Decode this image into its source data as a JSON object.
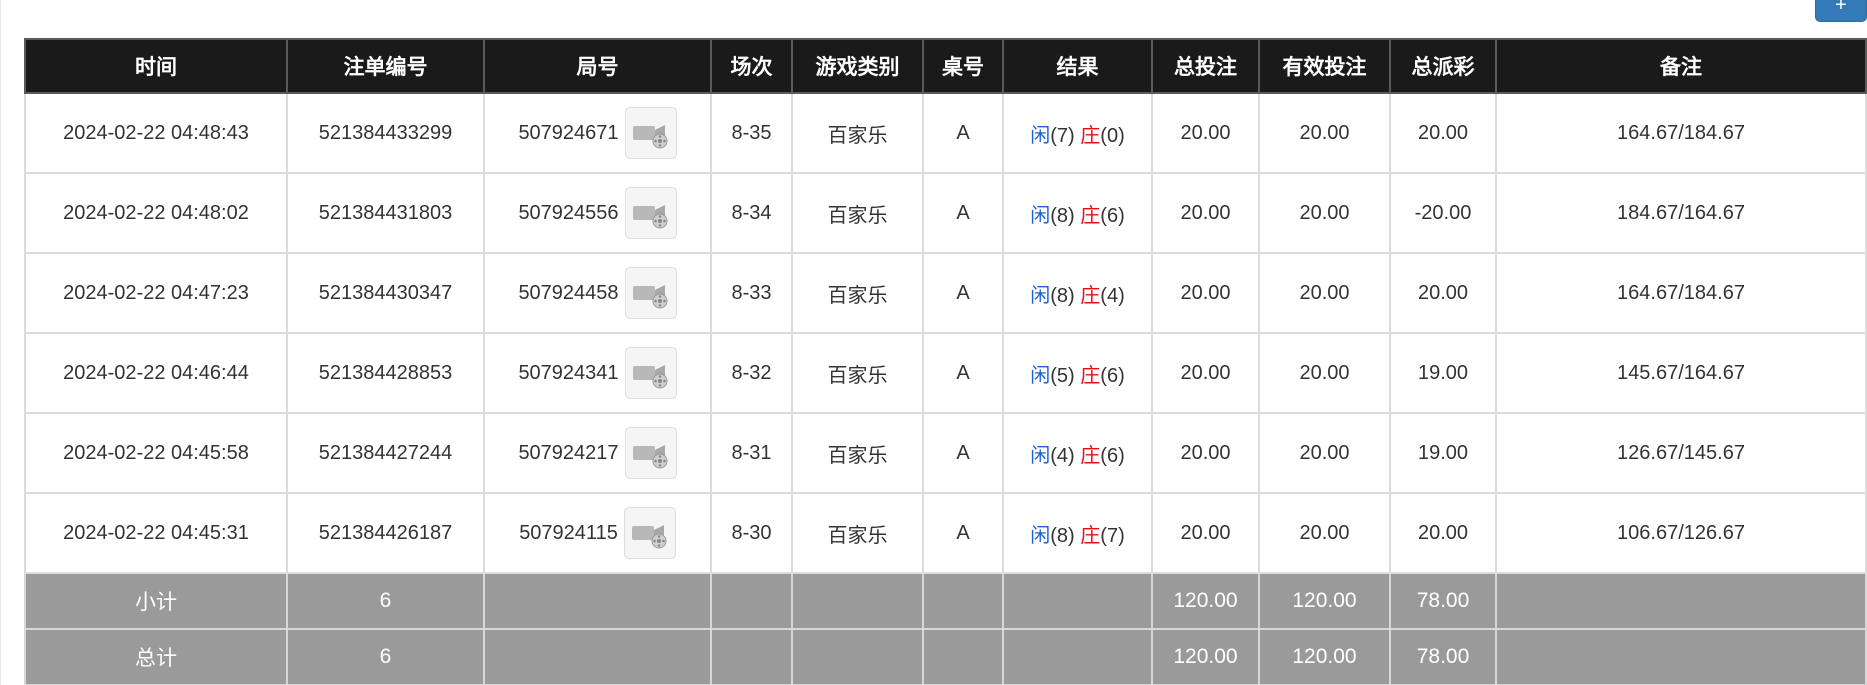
{
  "corner_button": {
    "label": "+"
  },
  "table": {
    "headers": [
      "时间",
      "注单编号",
      "局号",
      "场次",
      "游戏类别",
      "桌号",
      "结果",
      "总投注",
      "有效投注",
      "总派彩",
      "备注"
    ],
    "rows": [
      {
        "time": "2024-02-22 04:48:43",
        "bet_id": "521384433299",
        "round_id": "507924671",
        "session": "8-35",
        "game_type": "百家乐",
        "table_no": "A",
        "player_label": "闲",
        "player_score": "(7)",
        "banker_label": "庄",
        "banker_score": "(0)",
        "total_bet": "20.00",
        "valid_bet": "20.00",
        "payout": "20.00",
        "payout_status": "positive",
        "note": "164.67/184.67"
      },
      {
        "time": "2024-02-22 04:48:02",
        "bet_id": "521384431803",
        "round_id": "507924556",
        "session": "8-34",
        "game_type": "百家乐",
        "table_no": "A",
        "player_label": "闲",
        "player_score": "(8)",
        "banker_label": "庄",
        "banker_score": "(6)",
        "total_bet": "20.00",
        "valid_bet": "20.00",
        "payout": "-20.00",
        "payout_status": "negative",
        "note": "184.67/164.67"
      },
      {
        "time": "2024-02-22 04:47:23",
        "bet_id": "521384430347",
        "round_id": "507924458",
        "session": "8-33",
        "game_type": "百家乐",
        "table_no": "A",
        "player_label": "闲",
        "player_score": "(8)",
        "banker_label": "庄",
        "banker_score": "(4)",
        "total_bet": "20.00",
        "valid_bet": "20.00",
        "payout": "20.00",
        "payout_status": "positive",
        "note": "164.67/184.67"
      },
      {
        "time": "2024-02-22 04:46:44",
        "bet_id": "521384428853",
        "round_id": "507924341",
        "session": "8-32",
        "game_type": "百家乐",
        "table_no": "A",
        "player_label": "闲",
        "player_score": "(5)",
        "banker_label": "庄",
        "banker_score": "(6)",
        "total_bet": "20.00",
        "valid_bet": "20.00",
        "payout": "19.00",
        "payout_status": "positive",
        "note": "145.67/164.67"
      },
      {
        "time": "2024-02-22 04:45:58",
        "bet_id": "521384427244",
        "round_id": "507924217",
        "session": "8-31",
        "game_type": "百家乐",
        "table_no": "A",
        "player_label": "闲",
        "player_score": "(4)",
        "banker_label": "庄",
        "banker_score": "(6)",
        "total_bet": "20.00",
        "valid_bet": "20.00",
        "payout": "19.00",
        "payout_status": "positive",
        "note": "126.67/145.67"
      },
      {
        "time": "2024-02-22 04:45:31",
        "bet_id": "521384426187",
        "round_id": "507924115",
        "session": "8-30",
        "game_type": "百家乐",
        "table_no": "A",
        "player_label": "闲",
        "player_score": "(8)",
        "banker_label": "庄",
        "banker_score": "(7)",
        "total_bet": "20.00",
        "valid_bet": "20.00",
        "payout": "20.00",
        "payout_status": "positive",
        "note": "106.67/126.67"
      }
    ],
    "subtotal": {
      "label": "小计",
      "count": "6",
      "total_bet": "120.00",
      "valid_bet": "120.00",
      "payout": "78.00"
    },
    "grand_total": {
      "label": "总计",
      "count": "6",
      "total_bet": "120.00",
      "valid_bet": "120.00",
      "payout": "78.00"
    }
  },
  "colors": {
    "header_bg": "#1a1a1a",
    "footer_bg": "#9a9a9a",
    "blue": "#1e5fd6",
    "red": "#ea0d0d",
    "corner_button": "#337ab7"
  },
  "icons": {
    "video_replay": "video-camera-film-icon"
  }
}
